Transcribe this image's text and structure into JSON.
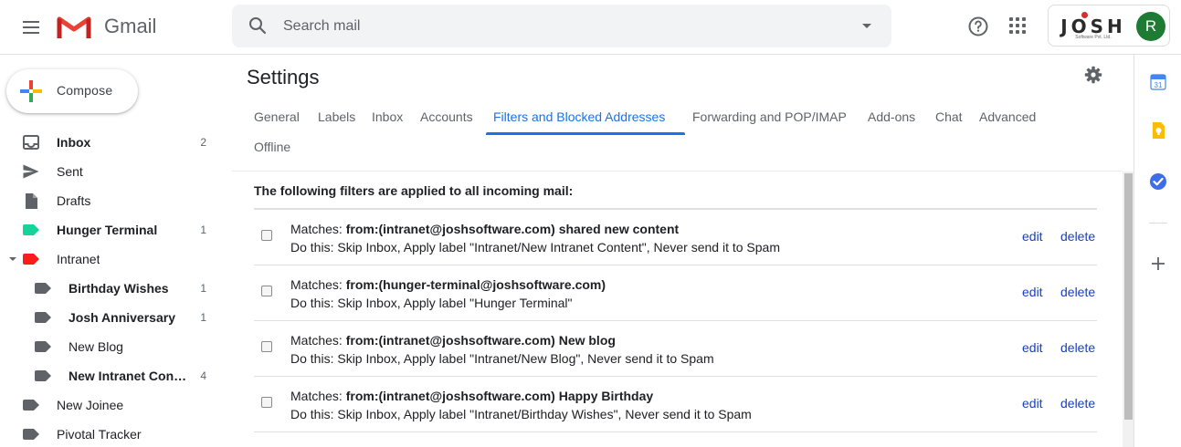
{
  "app": {
    "name": "Gmail"
  },
  "search": {
    "placeholder": "Search mail"
  },
  "account": {
    "brand": "JOSH",
    "brand_sub": "Software Pvt. Ltd.",
    "avatar_initial": "R"
  },
  "compose": {
    "label": "Compose"
  },
  "sidebar": {
    "items": [
      {
        "label": "Inbox",
        "count": "2",
        "bold": true
      },
      {
        "label": "Sent",
        "count": "",
        "bold": false
      },
      {
        "label": "Drafts",
        "count": "",
        "bold": false
      },
      {
        "label": "Hunger Terminal",
        "count": "1",
        "bold": true,
        "color": "#16d39a"
      },
      {
        "label": "Intranet",
        "count": "",
        "bold": false,
        "color": "#fb1d1d"
      },
      {
        "label": "Birthday Wishes",
        "count": "1",
        "bold": true
      },
      {
        "label": "Josh Anniversary",
        "count": "1",
        "bold": true
      },
      {
        "label": "New Blog",
        "count": "",
        "bold": false
      },
      {
        "label": "New Intranet Cont…",
        "count": "4",
        "bold": true
      },
      {
        "label": "New Joinee",
        "count": "",
        "bold": false
      },
      {
        "label": "Pivotal Tracker",
        "count": "",
        "bold": false
      }
    ]
  },
  "settings": {
    "title": "Settings",
    "tabs": [
      "General",
      "Labels",
      "Inbox",
      "Accounts",
      "Filters and Blocked Addresses",
      "Forwarding and POP/IMAP",
      "Add-ons",
      "Chat",
      "Advanced",
      "Offline"
    ],
    "active_tab": "Filters and Blocked Addresses",
    "filters_heading": "The following filters are applied to all incoming mail:",
    "matches_prefix": "Matches: ",
    "edit_label": "edit",
    "delete_label": "delete",
    "filters": [
      {
        "match": "from:(intranet@joshsoftware.com) shared new content",
        "action": "Do this: Skip Inbox, Apply label \"Intranet/New Intranet Content\", Never send it to Spam"
      },
      {
        "match": "from:(hunger-terminal@joshsoftware.com)",
        "action": "Do this: Skip Inbox, Apply label \"Hunger Terminal\""
      },
      {
        "match": "from:(intranet@joshsoftware.com) New blog",
        "action": "Do this: Skip Inbox, Apply label \"Intranet/New Blog\", Never send it to Spam"
      },
      {
        "match": "from:(intranet@joshsoftware.com) Happy Birthday",
        "action": "Do this: Skip Inbox, Apply label \"Intranet/Birthday Wishes\", Never send it to Spam"
      }
    ]
  },
  "colors": {
    "accent": "#1a73e8",
    "link": "#1a3fbd",
    "avatar": "#1e7b34"
  },
  "side_panel": {
    "icons": [
      "calendar-icon",
      "keep-icon",
      "tasks-icon",
      "add-icon"
    ],
    "calendar_day": "31"
  }
}
